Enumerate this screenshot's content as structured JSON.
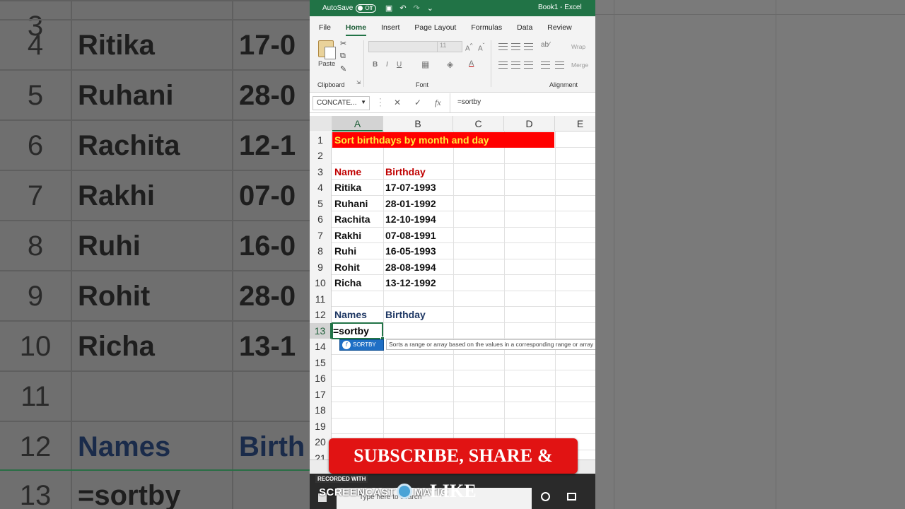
{
  "window": {
    "title": "Book1 - Excel",
    "autosave_label": "AutoSave",
    "autosave_state": "Off"
  },
  "menu": [
    "File",
    "Home",
    "Insert",
    "Page Layout",
    "Formulas",
    "Data",
    "Review"
  ],
  "ribbon": {
    "paste_label": "Paste",
    "clipboard_label": "Clipboard",
    "font_label": "Font",
    "alignment_label": "Alignment",
    "font_size": "11",
    "bold": "B",
    "italic": "I",
    "underline": "U",
    "wrap_label": "Wrap",
    "merge_label": "Merge"
  },
  "formula_bar": {
    "name_box": "CONCATE...",
    "formula": "=sortby",
    "cancel": "✕",
    "enter": "✓",
    "fx": "fx"
  },
  "columns": [
    "A",
    "B",
    "C",
    "D",
    "E"
  ],
  "rows": [
    "1",
    "2",
    "3",
    "4",
    "5",
    "6",
    "7",
    "8",
    "9",
    "10",
    "11",
    "12",
    "13",
    "14",
    "15",
    "16",
    "17",
    "18",
    "19",
    "20",
    "21"
  ],
  "sheet": {
    "title": "Sort birthdays by month and day",
    "header_name": "Name",
    "header_birthday": "Birthday",
    "people": [
      {
        "name": "Ritika",
        "birthday": "17-07-1993"
      },
      {
        "name": "Ruhani",
        "birthday": "28-01-1992"
      },
      {
        "name": "Rachita",
        "birthday": "12-10-1994"
      },
      {
        "name": "Rakhi",
        "birthday": "07-08-1991"
      },
      {
        "name": "Ruhi",
        "birthday": "16-05-1993"
      },
      {
        "name": "Rohit",
        "birthday": "28-08-1994"
      },
      {
        "name": "Richa",
        "birthday": "13-12-1992"
      }
    ],
    "out_header_name": "Names",
    "out_header_birthday": "Birthday",
    "active_cell_text": "=sortby"
  },
  "autocomplete": {
    "item": "SORTBY",
    "tooltip": "Sorts a range or array based on the values in a corresponding range or array"
  },
  "overlay": {
    "subscribe": "SUBSCRIBE, SHARE & LIKE",
    "recorded_with": "RECORDED WITH",
    "brand_left": "SCREENCAST",
    "brand_right": "MATIC",
    "taskbar_search": "Type here to search"
  },
  "background": {
    "rows": [
      {
        "num": "4",
        "name": "Ritika",
        "bday": "17-0"
      },
      {
        "num": "5",
        "name": "Ruhani",
        "bday": "28-0"
      },
      {
        "num": "6",
        "name": "Rachita",
        "bday": "12-1"
      },
      {
        "num": "7",
        "name": "Rakhi",
        "bday": "07-0"
      },
      {
        "num": "8",
        "name": "Ruhi",
        "bday": "16-0"
      },
      {
        "num": "9",
        "name": "Rohit",
        "bday": "28-0"
      },
      {
        "num": "10",
        "name": "Richa",
        "bday": "13-1"
      },
      {
        "num": "11",
        "name": "",
        "bday": ""
      },
      {
        "num": "12",
        "name": "Names",
        "bday": "Birth"
      },
      {
        "num": "13",
        "name": "=sortby",
        "bday": ""
      }
    ]
  },
  "colors": {
    "excel_green": "#217346",
    "title_fill": "#ff0000",
    "title_text": "#ffeb3b",
    "header_red": "#c00000",
    "header_navy": "#1f3864",
    "subscribe_red": "#e11313"
  }
}
